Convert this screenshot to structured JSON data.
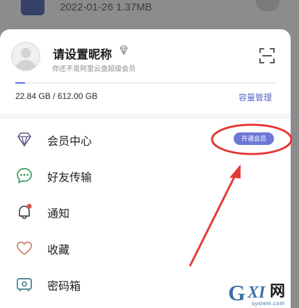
{
  "background_file": {
    "meta": "2022-01-26 1.37MB",
    "thumb_icon": "file-thumbnail-icon",
    "action_icon": "more-action-icon"
  },
  "profile": {
    "nickname": "请设置昵称",
    "member_status": "你还不是阿里云盘超级会员",
    "avatar_icon": "default-avatar-icon",
    "badge_icon": "diamond-icon",
    "scan_icon": "scan-icon"
  },
  "storage": {
    "used_text": "22.84 GB / 612.00 GB",
    "used_fraction": 0.037,
    "manage_label": "容量管理"
  },
  "menu": {
    "items": [
      {
        "label": "会员中心",
        "icon": "diamond-icon",
        "badge": "开通会员"
      },
      {
        "label": "好友传输",
        "icon": "chat-bubble-icon"
      },
      {
        "label": "通知",
        "icon": "bell-icon",
        "has_dot": true
      },
      {
        "label": "收藏",
        "icon": "heart-icon"
      },
      {
        "label": "密码箱",
        "icon": "safe-box-icon"
      }
    ]
  },
  "annotation": {
    "color": "#e53935"
  },
  "watermark": {
    "g": "G",
    "xi": "XI",
    "wang": "网",
    "domain": "system.com"
  },
  "colors": {
    "accent": "#5b6bf5",
    "vip_pill": "#6d78d6",
    "link": "#5866c8",
    "notify_dot": "#e0524a"
  }
}
